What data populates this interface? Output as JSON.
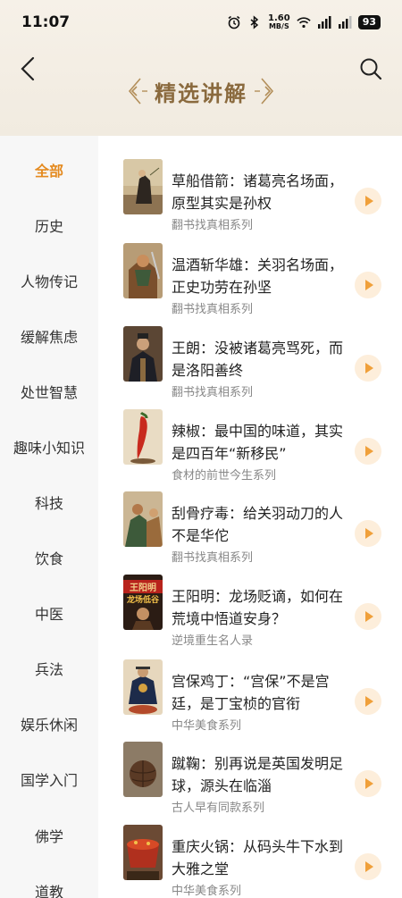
{
  "status": {
    "time": "11:07",
    "speed_top": "1.60",
    "speed_bottom": "MB/S",
    "battery": "93"
  },
  "header": {
    "title": "精选讲解"
  },
  "sidebar": {
    "items": [
      "全部",
      "历史",
      "人物传记",
      "缓解焦虑",
      "处世智慧",
      "趣味小知识",
      "科技",
      "饮食",
      "中医",
      "兵法",
      "娱乐休闲",
      "国学入门",
      "佛学",
      "道教"
    ],
    "active_index": 0
  },
  "list": {
    "items": [
      {
        "title": "草船借箭：诸葛亮名场面，原型其实是孙权",
        "series": "翻书找真相系列"
      },
      {
        "title": "温酒斩华雄：关羽名场面，正史功劳在孙坚",
        "series": "翻书找真相系列"
      },
      {
        "title": "王朗：没被诸葛亮骂死，而是洛阳善终",
        "series": "翻书找真相系列"
      },
      {
        "title": "辣椒：最中国的味道，其实是四百年“新移民”",
        "series": "食材的前世今生系列"
      },
      {
        "title": "刮骨疗毒：给关羽动刀的人不是华佗",
        "series": "翻书找真相系列"
      },
      {
        "title": "王阳明：龙场贬谪，如何在荒境中悟道安身？",
        "series": "逆境重生名人录"
      },
      {
        "title": "宫保鸡丁：“宫保”不是宫廷，是丁宝桢的官衔",
        "series": "中华美食系列"
      },
      {
        "title": "蹴鞠：别再说是英国发明足球，源头在临淄",
        "series": "古人早有同款系列"
      },
      {
        "title": "重庆火锅：从码头牛下水到大雅之堂",
        "series": "中华美食系列"
      }
    ],
    "thumb_text": {
      "line1": "王阳明",
      "line2": "龙场低谷"
    }
  },
  "colors": {
    "accent": "#e48a1f",
    "play_bg": "#fdeedb",
    "title_gold": "#8a6a3e"
  }
}
